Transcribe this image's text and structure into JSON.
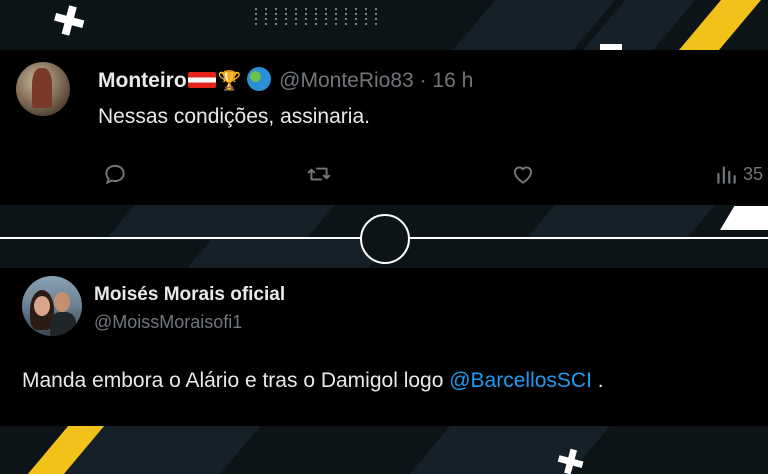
{
  "colors": {
    "background": "#0d1418",
    "accent_yellow": "#f2c21b",
    "tweet_bg": "#000000",
    "text_primary": "#e7e9ea",
    "text_secondary": "#71767b",
    "mention": "#1d9bf0"
  },
  "tweet1": {
    "name": "Monteiro",
    "emoji": [
      "austria-flag",
      "trophy",
      "globe"
    ],
    "handle": "@MonteRio83",
    "separator": "·",
    "time": "16 h",
    "text": "Nessas condições, assinaria.",
    "views": "35",
    "icons": [
      "reply-icon",
      "retweet-icon",
      "like-icon",
      "views-icon"
    ]
  },
  "tweet2": {
    "name": "Moisés Morais oficial",
    "handle": "@MoissMoraisofi1",
    "text_before": "Manda embora o Alário e tras o Damigol logo ",
    "mention": "@BarcellosSCI",
    "text_after": " ."
  }
}
